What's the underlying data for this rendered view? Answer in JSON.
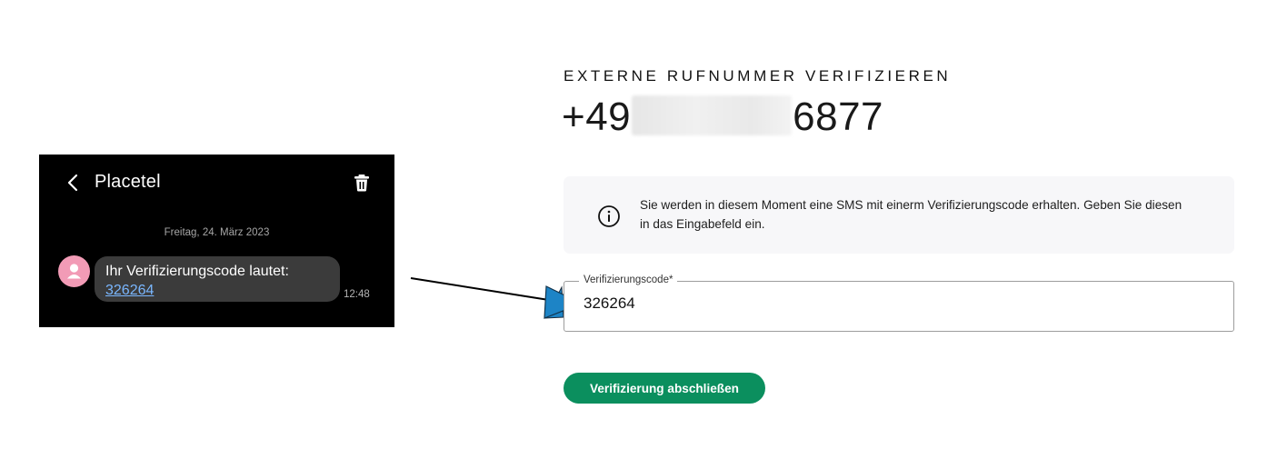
{
  "sms_screenshot": {
    "contact_name": "Placetel",
    "date_label": "Freitag, 24. März 2023",
    "message_text": "Ihr Verifizierungscode lautet:",
    "message_code": "326264",
    "message_time": "12:48",
    "icons": {
      "back": "chevron-left-icon",
      "delete": "trash-icon",
      "avatar": "person-icon"
    },
    "colors": {
      "background": "#000000",
      "bubble": "#3b3b3b",
      "avatar": "#f29bb6",
      "link": "#7ab7ff"
    }
  },
  "verification": {
    "heading": "EXTERNE RUFNUMMER VERIFIZIEREN",
    "phone_prefix": "+49",
    "phone_suffix": "6877",
    "info_text": "Sie werden in diesem Moment eine SMS mit einerm Verifizierungscode erhalten. Geben Sie diesen in das Eingabefeld ein.",
    "info_icon": "info-circle-icon",
    "code_field": {
      "label": "Verifizierungscode*",
      "value": "326264"
    },
    "submit_label": "Verifizierung abschließen",
    "colors": {
      "button": "#0b8f5e",
      "info_background": "#f7f7f9",
      "arrow_fill": "#1d84c6"
    }
  }
}
